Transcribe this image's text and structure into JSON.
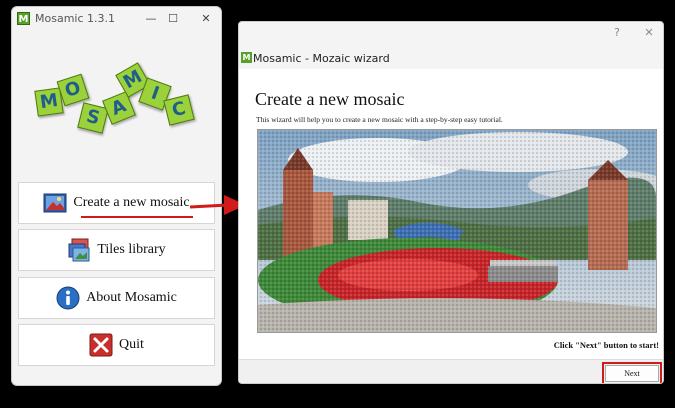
{
  "main_window": {
    "title": "Mosamic 1.3.1",
    "icon_letter": "M",
    "controls": {
      "minimize": "—",
      "maximize": "☐",
      "close": "✕"
    },
    "logo_letters": [
      "M",
      "O",
      "S",
      "A",
      "M",
      "I",
      "C"
    ],
    "buttons": [
      {
        "label": "Create a new mosaic",
        "icon": "picture-icon"
      },
      {
        "label": "Tiles library",
        "icon": "tiles-icon"
      },
      {
        "label": "About Mosamic",
        "icon": "info-icon"
      },
      {
        "label": "Quit",
        "icon": "quit-icon"
      }
    ]
  },
  "wizard_window": {
    "title": "Mosamic - Mozaic wizard",
    "icon_letter": "M",
    "controls": {
      "help": "?",
      "close": "✕"
    },
    "heading": "Create a new mosaic",
    "description": "This wizard will help you to create a new mosaic with a step-by-step easy tutorial.",
    "hint": "Click \"Next\" button to start!",
    "next_label": "Next"
  },
  "colors": {
    "highlight_red": "#d11a1a",
    "logo_tile": "#9bd13a",
    "logo_letter": "#1f5e8a"
  }
}
